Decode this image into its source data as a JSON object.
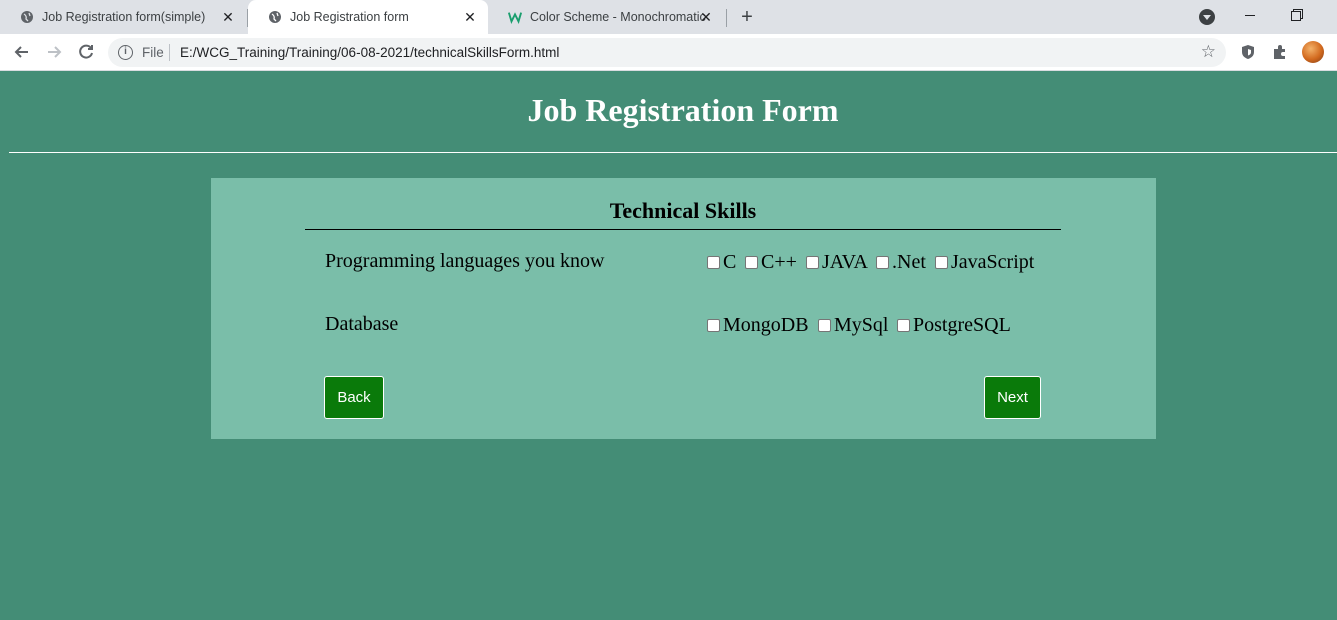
{
  "browser": {
    "tabs": [
      {
        "title": "Job Registration form(simple)",
        "icon": "globe-icon",
        "active": false
      },
      {
        "title": "Job Registration form",
        "icon": "globe-icon",
        "active": true
      },
      {
        "title": "Color Scheme - Monochromatic",
        "icon": "w-logo-icon",
        "active": false
      }
    ],
    "close_glyph": "✕",
    "new_tab_glyph": "+",
    "address": {
      "security_label": "File",
      "url": "E:/WCG_Training/Training/06-08-2021/technicalSkillsForm.html"
    }
  },
  "page": {
    "title": "Job Registration Form",
    "section_title": "Technical Skills",
    "programming": {
      "label": "Programming languages you know",
      "options": [
        "C",
        "C++",
        "JAVA",
        ".Net",
        "JavaScript"
      ]
    },
    "database": {
      "label": "Database",
      "options": [
        "MongoDB",
        "MySql",
        "PostgreSQL"
      ]
    },
    "back_label": "Back",
    "next_label": "Next"
  },
  "colors": {
    "page_bg": "#448d76",
    "card_bg": "#7abea9",
    "button_bg": "#0a7a0a"
  }
}
